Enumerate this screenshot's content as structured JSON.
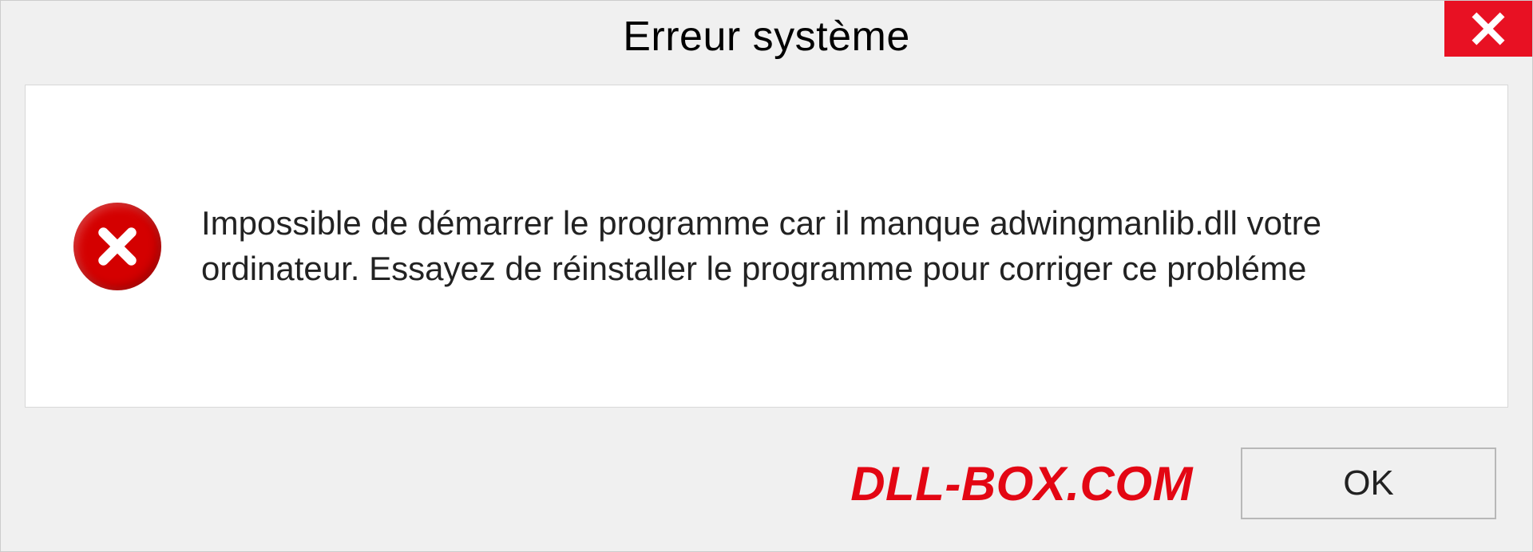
{
  "dialog": {
    "title": "Erreur système",
    "message": "Impossible de démarrer le programme car il manque adwingmanlib.dll votre ordinateur. Essayez de réinstaller le programme pour corriger ce probléme",
    "watermark": "DLL-BOX.COM",
    "ok_label": "OK"
  }
}
